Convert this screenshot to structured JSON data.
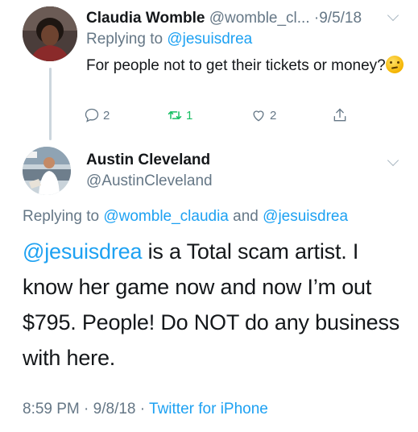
{
  "parent_tweet": {
    "display_name": "Claudia Womble",
    "handle": "@womble_cl...",
    "date": "9/5/18",
    "replying_prefix": "Replying to",
    "replying_to": "@jesuisdrea",
    "text": "For people not to get their tickets or money?",
    "emoji": "thinking-face",
    "actions": {
      "reply_count": "2",
      "retweet_count": "1",
      "like_count": "2"
    }
  },
  "main_tweet": {
    "display_name": "Austin Cleveland",
    "handle": "@AustinCleveland",
    "replying_prefix": "Replying to",
    "replying_to_1": "@womble_claudia",
    "replying_and": "and",
    "replying_to_2": "@jesuisdrea",
    "mention": "@jesuisdrea",
    "text": " is a Total scam artist. I know her game now and now I’m out $795. People! Do NOT do any business with here.",
    "time": "8:59 PM",
    "date": "9/8/18",
    "source": "Twitter for iPhone"
  },
  "colors": {
    "link": "#1da1f2",
    "muted": "#657786",
    "retweet_green": "#17bf63"
  }
}
